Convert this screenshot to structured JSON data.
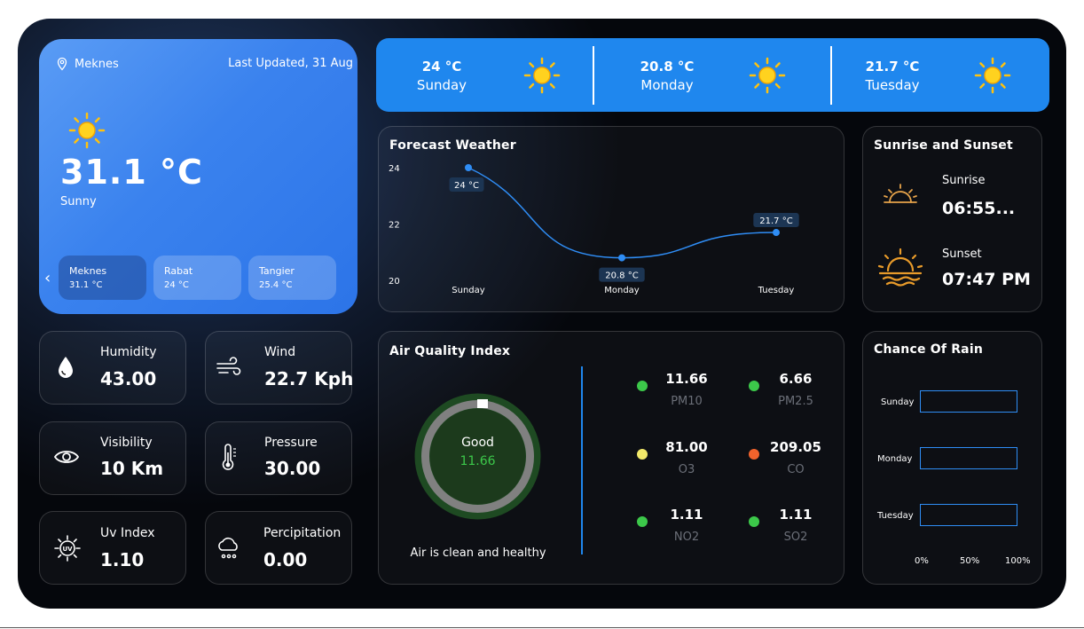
{
  "location": {
    "city": "Meknes",
    "updated": "Last Updated, 31 Aug"
  },
  "current": {
    "temp": "31.1 °C",
    "condition": "Sunny"
  },
  "cities": [
    {
      "name": "Meknes",
      "temp": "31.1 °C"
    },
    {
      "name": "Rabat",
      "temp": "24 °C"
    },
    {
      "name": "Tangier",
      "temp": "25.4 °C"
    }
  ],
  "forecast_days": [
    {
      "temp": "24 °C",
      "day": "Sunday"
    },
    {
      "temp": "20.8 °C",
      "day": "Monday"
    },
    {
      "temp": "21.7 °C",
      "day": "Tuesday"
    }
  ],
  "stats": {
    "humidity": {
      "label": "Humidity",
      "value": "43.00"
    },
    "wind": {
      "label": "Wind",
      "value": "22.7 Kph"
    },
    "visibility": {
      "label": "Visibility",
      "value": "10 Km"
    },
    "pressure": {
      "label": "Pressure",
      "value": "30.00"
    },
    "uv": {
      "label": "Uv Index",
      "value": "1.10"
    },
    "precip": {
      "label": "Percipitation",
      "value": "0.00"
    }
  },
  "forecast_chart": {
    "title": "Forecast Weather",
    "y_ticks": [
      "24",
      "22",
      "20"
    ],
    "categories": [
      "Sunday",
      "Monday",
      "Tuesday"
    ],
    "values": [
      24,
      20.8,
      21.7
    ],
    "labels": [
      "24 °C",
      "20.8 °C",
      "21.7 °C"
    ],
    "ylim": [
      20,
      24
    ]
  },
  "sun": {
    "title": "Sunrise and Sunset",
    "sunrise_label": "Sunrise",
    "sunrise_time": "06:55...",
    "sunset_label": "Sunset",
    "sunset_time": "07:47 PM"
  },
  "aqi": {
    "title": "Air Quality Index",
    "status": "Good",
    "value": "11.66",
    "message": "Air is clean and healthy",
    "pollutants": [
      {
        "value": "11.66",
        "name": "PM10",
        "color": "#3cc84a"
      },
      {
        "value": "6.66",
        "name": "PM2.5",
        "color": "#3cc84a"
      },
      {
        "value": "81.00",
        "name": "O3",
        "color": "#f2e96a"
      },
      {
        "value": "209.05",
        "name": "CO",
        "color": "#f2632c"
      },
      {
        "value": "1.11",
        "name": "NO2",
        "color": "#3cc84a"
      },
      {
        "value": "1.11",
        "name": "SO2",
        "color": "#3cc84a"
      }
    ]
  },
  "rain": {
    "title": "Chance Of Rain",
    "days": [
      "Sunday",
      "Monday",
      "Tuesday"
    ],
    "values": [
      0,
      0,
      0
    ],
    "ticks": [
      "0%",
      "50%",
      "100%"
    ]
  },
  "colors": {
    "accent": "#1f87ee",
    "card": "#3a82ee",
    "sun": "#ffc20e",
    "good": "#3cc84a"
  }
}
